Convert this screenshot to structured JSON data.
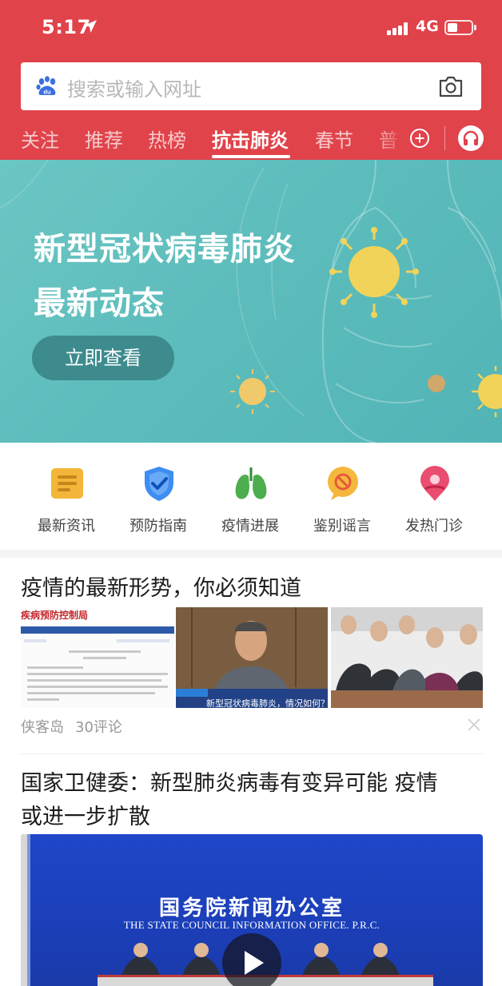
{
  "status_bar": {
    "time": "5:17",
    "network": "4G"
  },
  "search": {
    "placeholder": "搜索或输入网址"
  },
  "tabs": [
    {
      "label": "关注"
    },
    {
      "label": "推荐"
    },
    {
      "label": "热榜"
    },
    {
      "label": "抗击肺炎",
      "active": true
    },
    {
      "label": "春节"
    },
    {
      "label": "普"
    }
  ],
  "banner": {
    "title_line1": "新型冠状病毒肺炎",
    "title_line2": "最新动态",
    "button_label": "立即查看"
  },
  "quick_entries": [
    {
      "label": "最新资讯",
      "icon": "news-icon",
      "color": "#f3b63a"
    },
    {
      "label": "预防指南",
      "icon": "shield-check-icon",
      "color": "#3d8df2"
    },
    {
      "label": "疫情进展",
      "icon": "lungs-icon",
      "color": "#4cae4f"
    },
    {
      "label": "鉴别谣言",
      "icon": "prohibited-icon",
      "color": "#f5b83d"
    },
    {
      "label": "发热门诊",
      "icon": "location-pin-icon",
      "color": "#ea4d6f"
    }
  ],
  "feed": [
    {
      "title": "疫情的最新形势，你必须知道",
      "thumbnails": {
        "doc_header": "疾病预防控制局",
        "video_caption": "新型冠状病毒肺炎，情况如何？"
      },
      "source": "侠客岛",
      "comments": "30评论"
    },
    {
      "title_line1": "国家卫健委：新型肺炎病毒有变异可能 疫情",
      "title_line2": "或进一步扩散",
      "video": {
        "banner_cn": "国务院新闻办公室",
        "banner_en": "THE STATE COUNCIL INFORMATION OFFICE. P.R.C."
      }
    }
  ],
  "colors": {
    "header": "#e0434a",
    "banner": "#5dbdbc",
    "banner_button": "#3d8b8d",
    "video_bg": "#1f46c8"
  }
}
